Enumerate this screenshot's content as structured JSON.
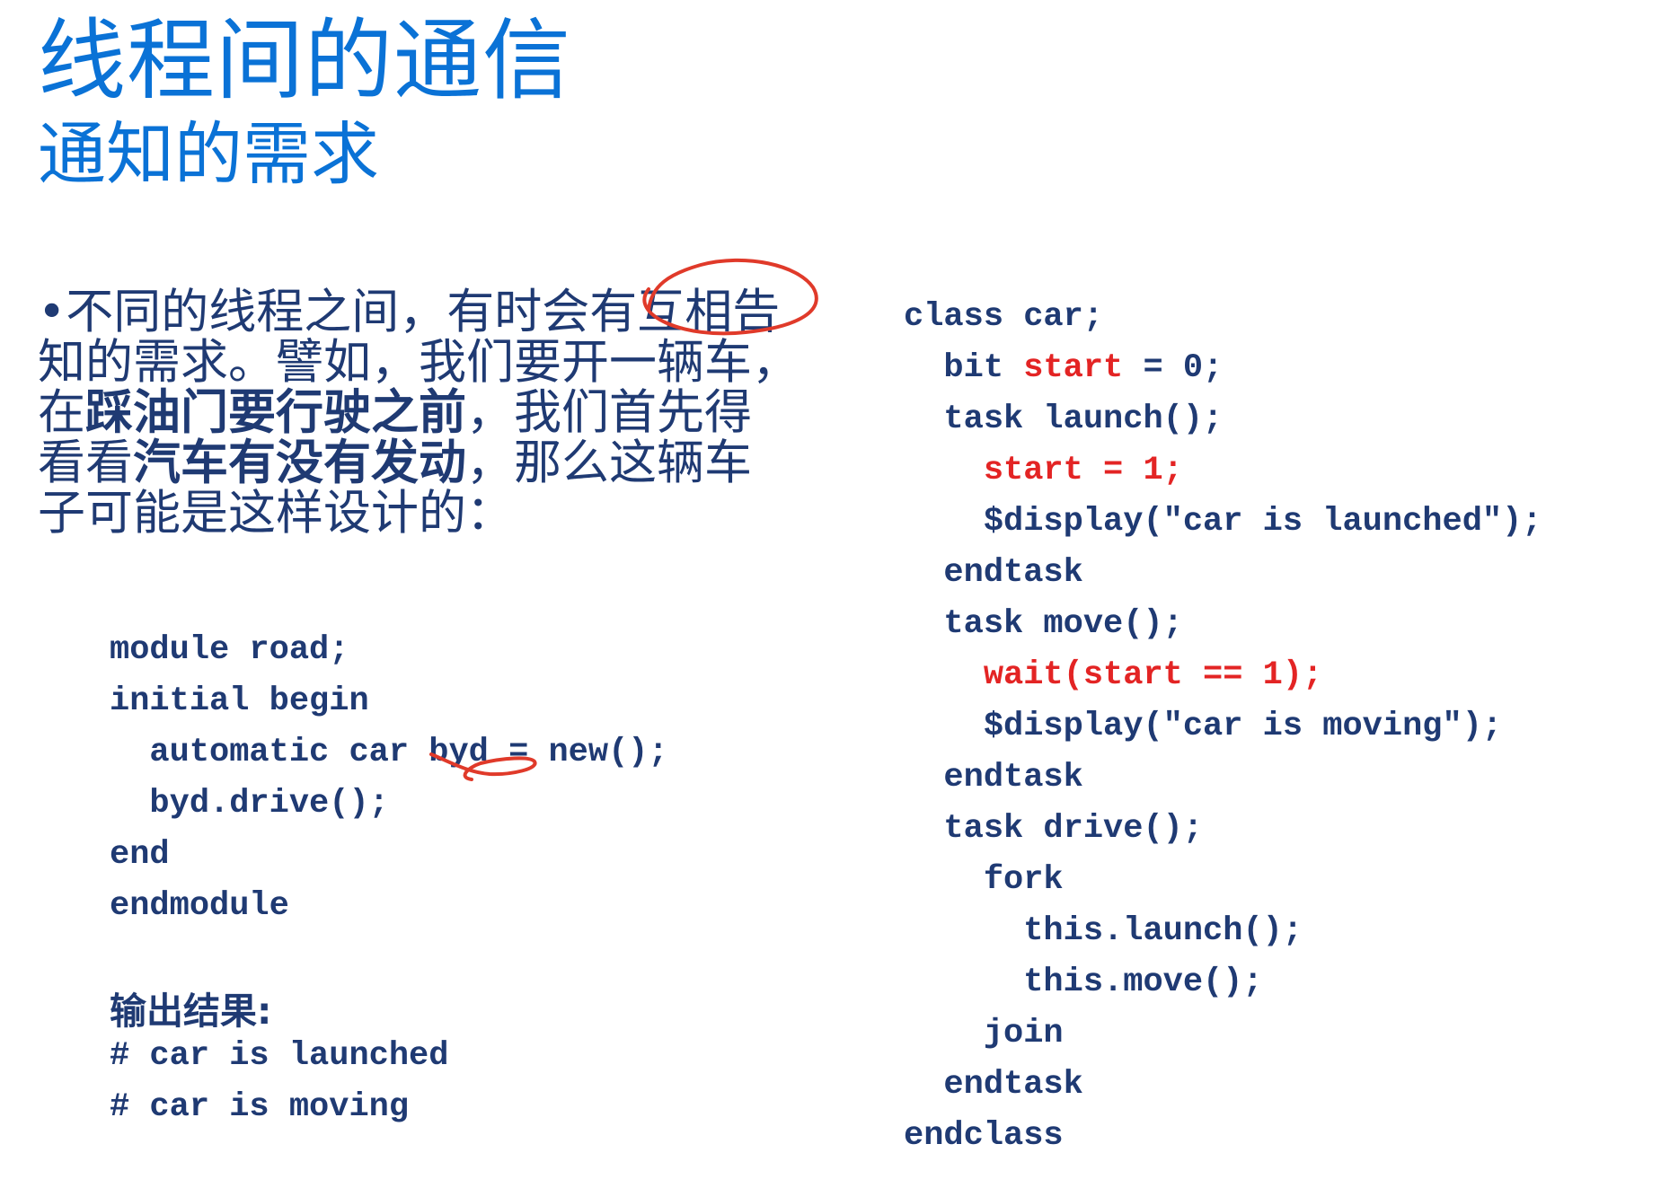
{
  "title": "线程间的通信",
  "subtitle": "通知的需求",
  "intro": {
    "bullet": "•",
    "l1": "不同的线程之间，有时会有互相告",
    "l2": "知的需求。譬如，我们要开一辆车，",
    "l3a": "在",
    "l3b": "踩油门要行驶之前",
    "l3c": "，我们首先得",
    "l4a": "看看",
    "l4b": "汽车有没有发动",
    "l4c": "，那么这辆车",
    "l5": "子可能是这样设计的："
  },
  "left_code": [
    "module road;",
    "initial begin",
    "  automatic car byd = new();",
    "  byd.drive();",
    "end",
    "endmodule"
  ],
  "output": {
    "label": "输出结果:",
    "lines": [
      "# car is launched",
      "# car is moving"
    ]
  },
  "right_code": {
    "l1": "class car;",
    "l2a": "  bit ",
    "l2b": "start",
    "l2c": " = 0;",
    "l3": "  task launch();",
    "l4": "    start = 1;",
    "l5": "    $display(\"car is launched\");",
    "l6": "  endtask",
    "l7": "  task move();",
    "l8": "    wait(start == 1);",
    "l9": "    $display(\"car is moving\");",
    "l10": "  endtask",
    "l11": "  task drive();",
    "l12": "    fork",
    "l13": "      this.launch();",
    "l14": "      this.move();",
    "l15": "    join",
    "l16": "  endtask",
    "l17": "endclass"
  },
  "colors": {
    "title": "#0a72d6",
    "text": "#1f3a73",
    "highlight": "#e32424"
  }
}
